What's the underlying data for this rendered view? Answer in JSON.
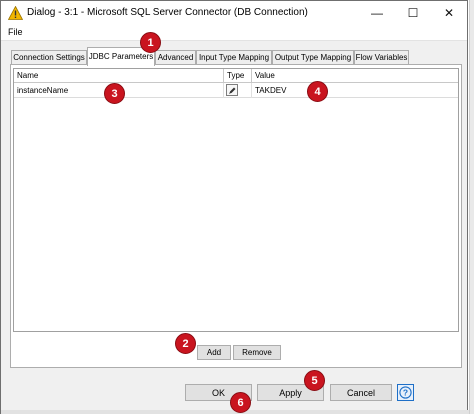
{
  "window": {
    "title": "Dialog - 3:1 - Microsoft SQL Server Connector (DB Connection)",
    "minimize_glyph": "—",
    "maximize_glyph": "☐",
    "close_glyph": "✕"
  },
  "menu": {
    "file": "File"
  },
  "tabs": [
    {
      "label": "Connection Settings"
    },
    {
      "label": "JDBC Parameters"
    },
    {
      "label": "Advanced"
    },
    {
      "label": "Input Type Mapping"
    },
    {
      "label": "Output Type Mapping"
    },
    {
      "label": "Flow Variables"
    }
  ],
  "active_tab": "JDBC Parameters",
  "table": {
    "columns": [
      "Name",
      "Type",
      "Value"
    ],
    "rows": [
      {
        "name": "instanceName",
        "type_icon": "pencil-icon",
        "value": "TAKDEV"
      }
    ]
  },
  "buttons": {
    "add": "Add",
    "remove": "Remove",
    "ok": "OK",
    "apply": "Apply",
    "cancel": "Cancel",
    "help": "?"
  },
  "markers": [
    "1",
    "2",
    "3",
    "4",
    "5",
    "6"
  ],
  "colors": {
    "marker": "#c9141f",
    "help_accent": "#1e6fc7",
    "warning_icon": "#f2b600"
  }
}
